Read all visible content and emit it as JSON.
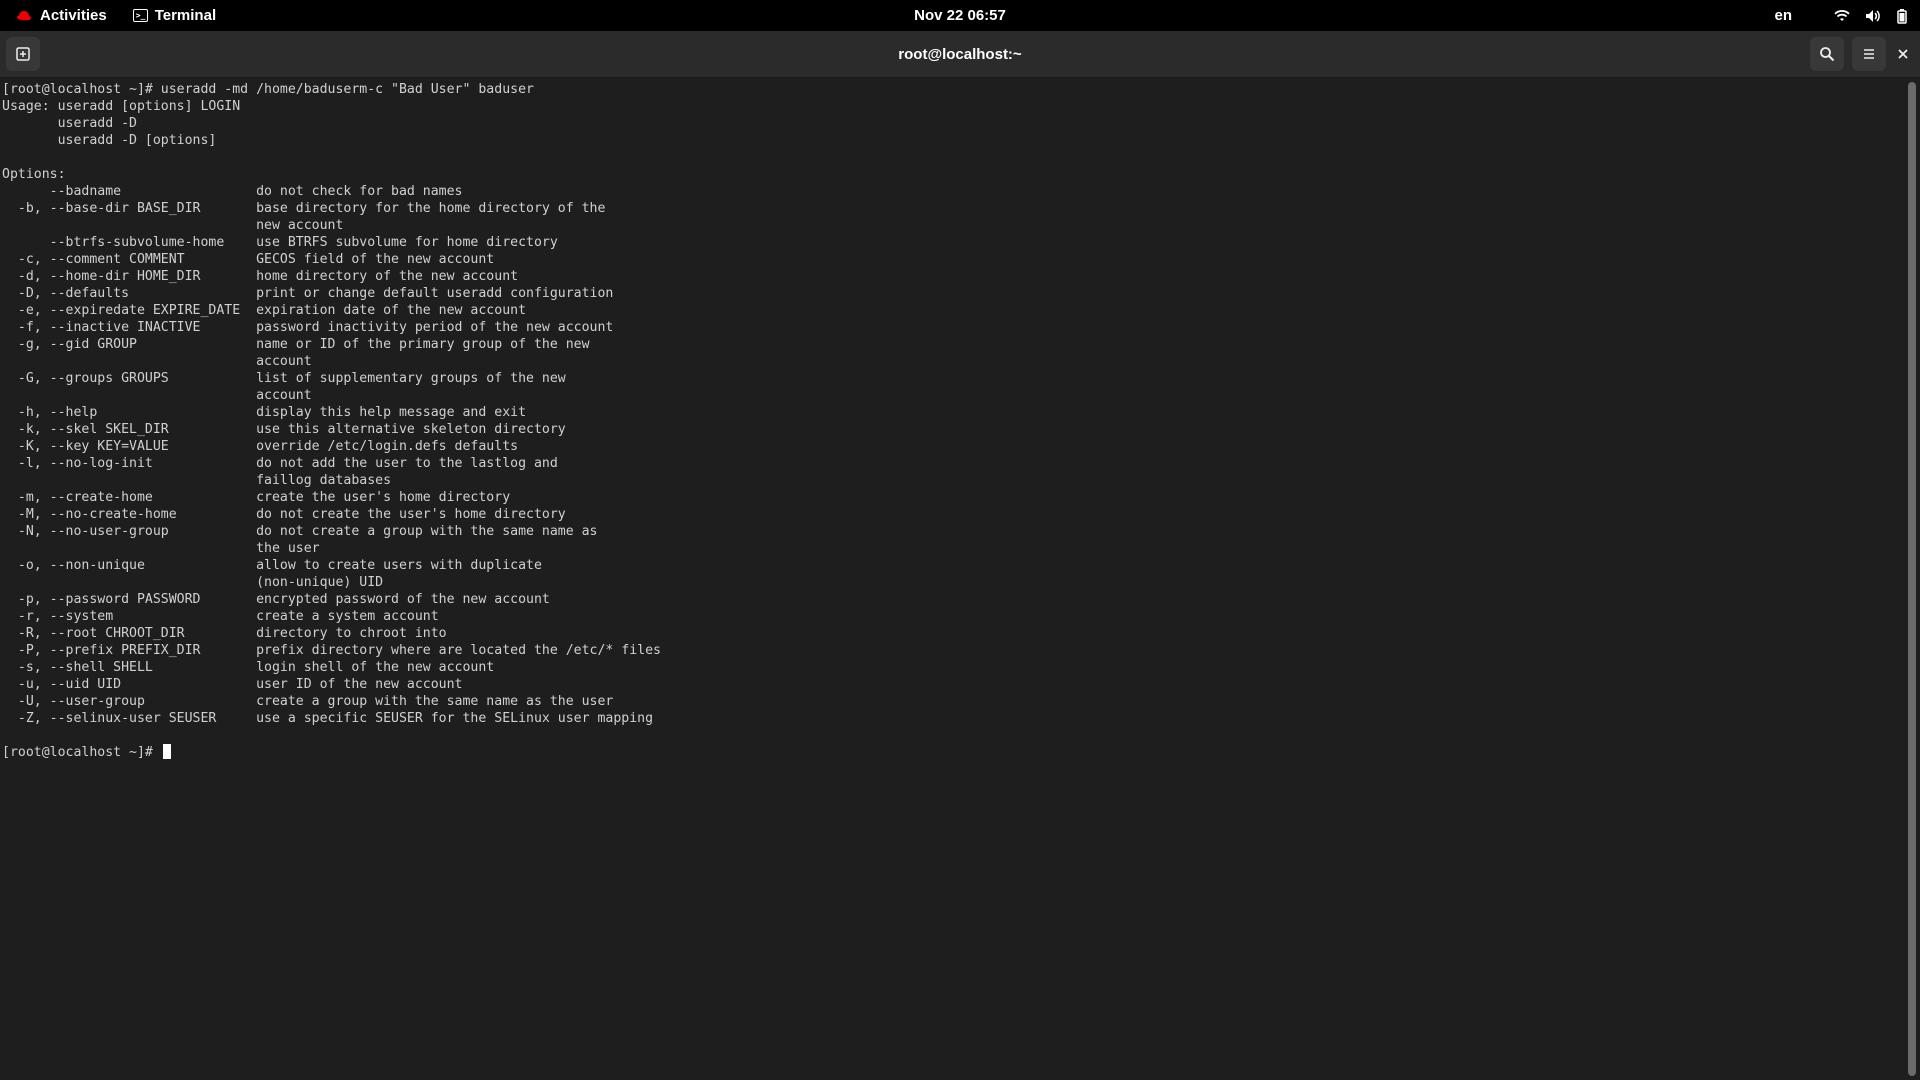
{
  "top_panel": {
    "activities_label": "Activities",
    "app_label": "Terminal",
    "clock": "Nov 22  06:57",
    "language": "en",
    "icons": [
      "wifi-icon",
      "volume-icon",
      "battery-icon"
    ]
  },
  "window": {
    "title": "root@localhost:~"
  },
  "terminal": {
    "lines": [
      "[root@localhost ~]# useradd -md /home/baduserm-c \"Bad User\" baduser",
      "Usage: useradd [options] LOGIN",
      "       useradd -D",
      "       useradd -D [options]",
      "",
      "Options:",
      "      --badname                 do not check for bad names",
      "  -b, --base-dir BASE_DIR       base directory for the home directory of the",
      "                                new account",
      "      --btrfs-subvolume-home    use BTRFS subvolume for home directory",
      "  -c, --comment COMMENT         GECOS field of the new account",
      "  -d, --home-dir HOME_DIR       home directory of the new account",
      "  -D, --defaults                print or change default useradd configuration",
      "  -e, --expiredate EXPIRE_DATE  expiration date of the new account",
      "  -f, --inactive INACTIVE       password inactivity period of the new account",
      "  -g, --gid GROUP               name or ID of the primary group of the new",
      "                                account",
      "  -G, --groups GROUPS           list of supplementary groups of the new",
      "                                account",
      "  -h, --help                    display this help message and exit",
      "  -k, --skel SKEL_DIR           use this alternative skeleton directory",
      "  -K, --key KEY=VALUE           override /etc/login.defs defaults",
      "  -l, --no-log-init             do not add the user to the lastlog and",
      "                                faillog databases",
      "  -m, --create-home             create the user's home directory",
      "  -M, --no-create-home          do not create the user's home directory",
      "  -N, --no-user-group           do not create a group with the same name as",
      "                                the user",
      "  -o, --non-unique              allow to create users with duplicate",
      "                                (non-unique) UID",
      "  -p, --password PASSWORD       encrypted password of the new account",
      "  -r, --system                  create a system account",
      "  -R, --root CHROOT_DIR         directory to chroot into",
      "  -P, --prefix PREFIX_DIR       prefix directory where are located the /etc/* files",
      "  -s, --shell SHELL             login shell of the new account",
      "  -u, --uid UID                 user ID of the new account",
      "  -U, --user-group              create a group with the same name as the user",
      "  -Z, --selinux-user SEUSER     use a specific SEUSER for the SELinux user mapping",
      ""
    ],
    "prompt": "[root@localhost ~]# "
  }
}
